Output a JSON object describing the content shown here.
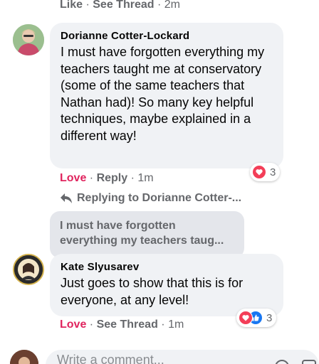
{
  "top_actions": {
    "like": "Like",
    "see_thread": "See Thread",
    "time": "2m"
  },
  "comment1": {
    "author": "Dorianne Cotter-Lockard",
    "text": "I must have forgotten everything my teachers taught me at conservatory (some of the same teachers that Nathan had)! So many key helpful techniques, maybe explained in a different way!",
    "actions": {
      "love": "Love",
      "reply": "Reply",
      "time": "1m"
    },
    "reactions": {
      "icons": [
        "heart-reaction-icon"
      ],
      "count": "3"
    }
  },
  "reply": {
    "replying_to": "Replying to Dorianne Cotter-...",
    "quoted_text": "I must have forgotten everything my teachers taug...",
    "author": "Kate Slyusarev",
    "text": "Just goes to show that this is for everyone, at any level!",
    "actions": {
      "love": "Love",
      "see_thread": "See Thread",
      "time": "1m"
    },
    "reactions": {
      "icons": [
        "heart-reaction-icon",
        "like-reaction-icon"
      ],
      "count": "3"
    }
  },
  "composer": {
    "placeholder": "Write a comment..."
  },
  "colors": {
    "love": "#e0245e",
    "bubble": "#f0f2f5",
    "muted": "#65676b",
    "like_blue": "#1877f2",
    "heart_red": "#f33e58"
  }
}
